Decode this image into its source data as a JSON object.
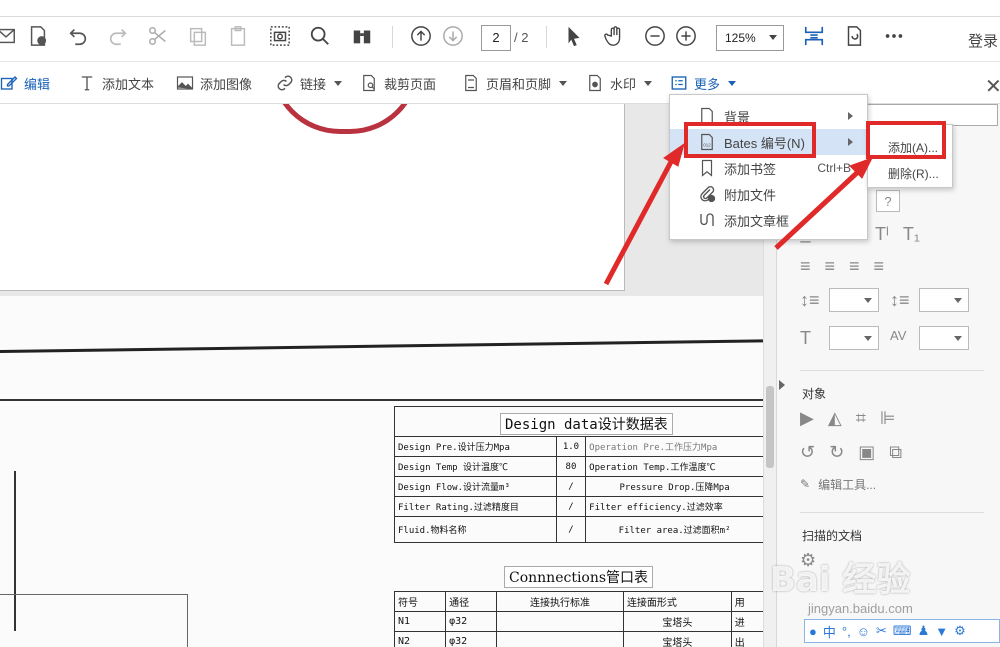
{
  "toolbar": {
    "page_current": "2",
    "page_total": "/ 2",
    "zoom": "125%",
    "login": "登录"
  },
  "toolbar2": {
    "edit": "编辑",
    "add_text": "添加文本",
    "add_image": "添加图像",
    "link": "链接",
    "crop": "裁剪页面",
    "header_footer": "页眉和页脚",
    "watermark": "水印",
    "more": "更多"
  },
  "menu": {
    "items": [
      {
        "label": "背景",
        "has_submenu": true
      },
      {
        "label": "Bates 编号(N)",
        "has_submenu": true
      },
      {
        "label": "添加书签",
        "shortcut": "Ctrl+B"
      },
      {
        "label": "附加文件"
      },
      {
        "label": "添加文章框"
      }
    ],
    "submenu": [
      "添加(A)...",
      "删除(R)..."
    ]
  },
  "right_panel": {
    "objects_label": "对象",
    "edit_tool": "编辑工具...",
    "scanned_docs": "扫描的文档"
  },
  "document": {
    "design_title": "Design data设计数据表",
    "design_rows": [
      [
        "Design Pre.设计压力Mpa",
        "1.0",
        "Operation Pre.工作压力Mpa"
      ],
      [
        "Design Temp 设计温度℃",
        "80",
        "Operation Temp.工作温度℃"
      ],
      [
        "Design Flow.设计流量m³",
        "/",
        "Pressure Drop.压降Mpa"
      ],
      [
        "Filter Rating.过滤精度目",
        "/",
        "Filter efficiency.过滤效率"
      ],
      [
        "Fluid.物料名称",
        "/",
        "Filter area.过滤面积m²"
      ]
    ],
    "conn_title": "Connnections管口表",
    "conn_header": [
      "符号",
      "通径",
      "连接执行标准",
      "连接面形式",
      "用"
    ],
    "conn_rows": [
      [
        "N1",
        "φ32",
        "",
        "宝塔头",
        "进"
      ],
      [
        "N2",
        "φ32",
        "",
        "宝塔头",
        "出"
      ]
    ]
  },
  "watermark": {
    "brand": "Bai 经验",
    "sub": "jingyan.baidu.com"
  },
  "ime": {
    "lang": "中"
  },
  "colors": {
    "accent": "#1a62b8",
    "highlight_box": "#e02a2a",
    "menu_highlight": "#d4e3f5"
  }
}
